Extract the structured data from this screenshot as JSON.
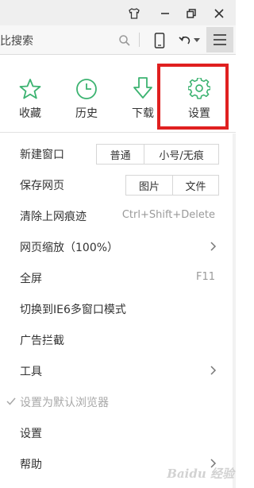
{
  "toolbar": {
    "search_text": "比搜索"
  },
  "quick_actions": [
    {
      "label": "收藏",
      "icon": "star-icon"
    },
    {
      "label": "历史",
      "icon": "clock-icon"
    },
    {
      "label": "下载",
      "icon": "download-icon"
    },
    {
      "label": "设置",
      "icon": "gear-icon"
    }
  ],
  "menu": {
    "new_window": {
      "label": "新建窗口",
      "option_normal": "普通",
      "option_private": "小号/无痕"
    },
    "save_page": {
      "label": "保存网页",
      "option_image": "图片",
      "option_file": "文件"
    },
    "clear_traces": {
      "label": "清除上网痕迹",
      "shortcut": "Ctrl+Shift+Delete"
    },
    "zoom": {
      "label": "网页缩放（100%）"
    },
    "fullscreen": {
      "label": "全屏",
      "shortcut": "F11"
    },
    "ie6_mode": {
      "label": "切换到IE6多窗口模式"
    },
    "adblock": {
      "label": "广告拦截"
    },
    "tools": {
      "label": "工具"
    },
    "default_browser": {
      "label": "设置为默认浏览器"
    },
    "settings": {
      "label": "设置"
    },
    "help": {
      "label": "帮助"
    }
  },
  "watermark": "Baidu 经验",
  "colors": {
    "accent": "#3cb371",
    "highlight": "#e02020"
  }
}
